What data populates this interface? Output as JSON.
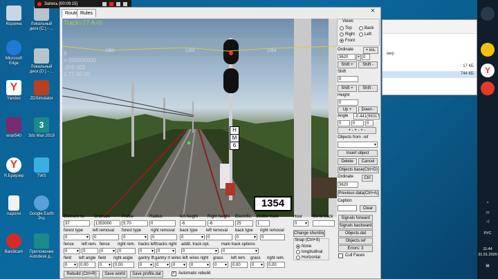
{
  "desktop": {
    "icons": [
      {
        "label": "Корзина",
        "color": "#c9d6e3"
      },
      {
        "label": "Локальный диск (C:) - ...",
        "color": "#b9c3cc"
      },
      {
        "label": "Microsoft Edge",
        "color": "#1f7ad6"
      },
      {
        "label": "Локальный диск (D:) - ...",
        "color": "#b9c3cc"
      },
      {
        "label": "Yandex",
        "color": "#e23b2b"
      },
      {
        "label": "ZDSimulator",
        "color": "#b7411e"
      },
      {
        "label": "wrar540",
        "color": "#7a2a6e"
      },
      {
        "label": "3ds Max 2019",
        "color": "#1a8a8a"
      },
      {
        "label": "Я.Браузер",
        "color": "#e6352b"
      },
      {
        "label": "TWS",
        "color": "#3bb0e0"
      },
      {
        "label": "пароли",
        "color": "#f2f2f2"
      },
      {
        "label": "Google Earth Pro",
        "color": "#5aa0d8"
      },
      {
        "label": "Bandicam",
        "color": "#d62a2a"
      },
      {
        "label": "Приложение Autodesk д...",
        "color": "#1a8a8a"
      }
    ]
  },
  "recorder": {
    "label": "Запись [00:09:15]"
  },
  "explorer": {
    "rows": [
      {
        "label": "мер",
        "size": "17 КБ"
      },
      {
        "label": "",
        "size": "744 КБ"
      }
    ]
  },
  "taskbar": {
    "lang": "РУС",
    "time": "11:44",
    "date": "31.01.2020"
  },
  "app": {
    "tabs": [
      "Route",
      "Rules"
    ],
    "overlay": {
      "track": "Track=77  A=0",
      "line1": "6",
      "line2": "= 200000000",
      "line3": "-200 002",
      "line4": "1.77 00.00",
      "marks": [
        "1352",
        "1353",
        "1354"
      ],
      "sign": [
        "Н",
        "М",
        "6"
      ],
      "post": "1354"
    },
    "views": {
      "title": "Views",
      "options": [
        "Top",
        "Back",
        "Right",
        "Left",
        "Front"
      ],
      "selected": "Front"
    },
    "ordinate": {
      "label": "Ordinate",
      "value": "3620",
      "plus": "+ ins.",
      "btn": "0"
    },
    "shift_buttons": [
      "Shift +",
      "Shift -"
    ],
    "shift": {
      "label": "Shift",
      "value": "0"
    },
    "height": {
      "label": "Height",
      "value": "0",
      "up": "Up +",
      "down": "Down -"
    },
    "angle": {
      "label": "Angle",
      "value": "-0.441(96317",
      "vals": [
        "0",
        "0",
        "0"
      ]
    },
    "objects_from": "Objects from  .ref",
    "insert": "Insert object",
    "delete": "Delete",
    "cancel": "Cancel",
    "objects_base": "Objects base(Ctrl+D)",
    "ordinate2": {
      "label": "Ordinate",
      "value": "3620",
      "ctrl": "Ctrl"
    },
    "previous": "Previous data(Ctrl+A)",
    "caption": {
      "label": "Caption",
      "clear": "Clear"
    },
    "right_buttons": [
      "Signals forward",
      "Signals backward",
      "Objects.dat",
      "Objects.ref",
      "Errors: 3"
    ],
    "cull_faces": "Cull Faces",
    "hour": {
      "label": "Hour",
      "value": "0"
    },
    "go_to_track": "Go to track",
    "change_shunting": "Change shunting",
    "snap": {
      "title": "Snap (Ctrl+S)",
      "options": [
        "None",
        "longitudinal",
        "Horizontal"
      ],
      "selected": "None"
    },
    "element": {
      "label": "Element №",
      "value": "37"
    },
    "ord": {
      "label": "Ordinate",
      "value": "1353000"
    },
    "profile": {
      "label": "Profile",
      "value": "5.70"
    },
    "radius": {
      "label": "Radius",
      "value": "0"
    },
    "left_height": {
      "label": "left height",
      "value": "-6"
    },
    "right_height": {
      "label": "Right height",
      "value": "-6"
    },
    "electrific": {
      "label": "Electrific.",
      "value": "25"
    },
    "double_track": {
      "label": "double track",
      "value": "1"
    },
    "row2_labels": [
      "forest type",
      "left removal",
      "forest type",
      "right removal",
      "back type",
      "left removal",
      "back type",
      "right removal"
    ],
    "row2_values": [
      "0",
      "0",
      "0",
      "0",
      "0",
      "0",
      "0",
      "0"
    ],
    "row3_labels": [
      "fence",
      "left rem.",
      "fence",
      "right rem.",
      "tracks left",
      "tracks right",
      "addit. track opt.",
      "main track options"
    ],
    "row3_values": [
      "0",
      "0",
      "0",
      "0",
      "0",
      "0",
      "0",
      "0"
    ],
    "row4_labels": [
      "field",
      "left angle",
      "field",
      "right angle",
      "gantry lft",
      "gantry rt",
      "wires left",
      "wires right",
      "grass",
      "left rem.",
      "grass",
      "right rem."
    ],
    "row4_values": [
      "0",
      "0.00",
      "0",
      "0.00",
      "0",
      "0",
      "0",
      "0",
      "0",
      "0.00",
      "0",
      "0.00"
    ],
    "rebuild": "Rebuild (Ctrl+R)",
    "save_world": "Save world",
    "save_profile": "Save profile.dat",
    "auto_rebuild": "Automatic rebuild"
  }
}
